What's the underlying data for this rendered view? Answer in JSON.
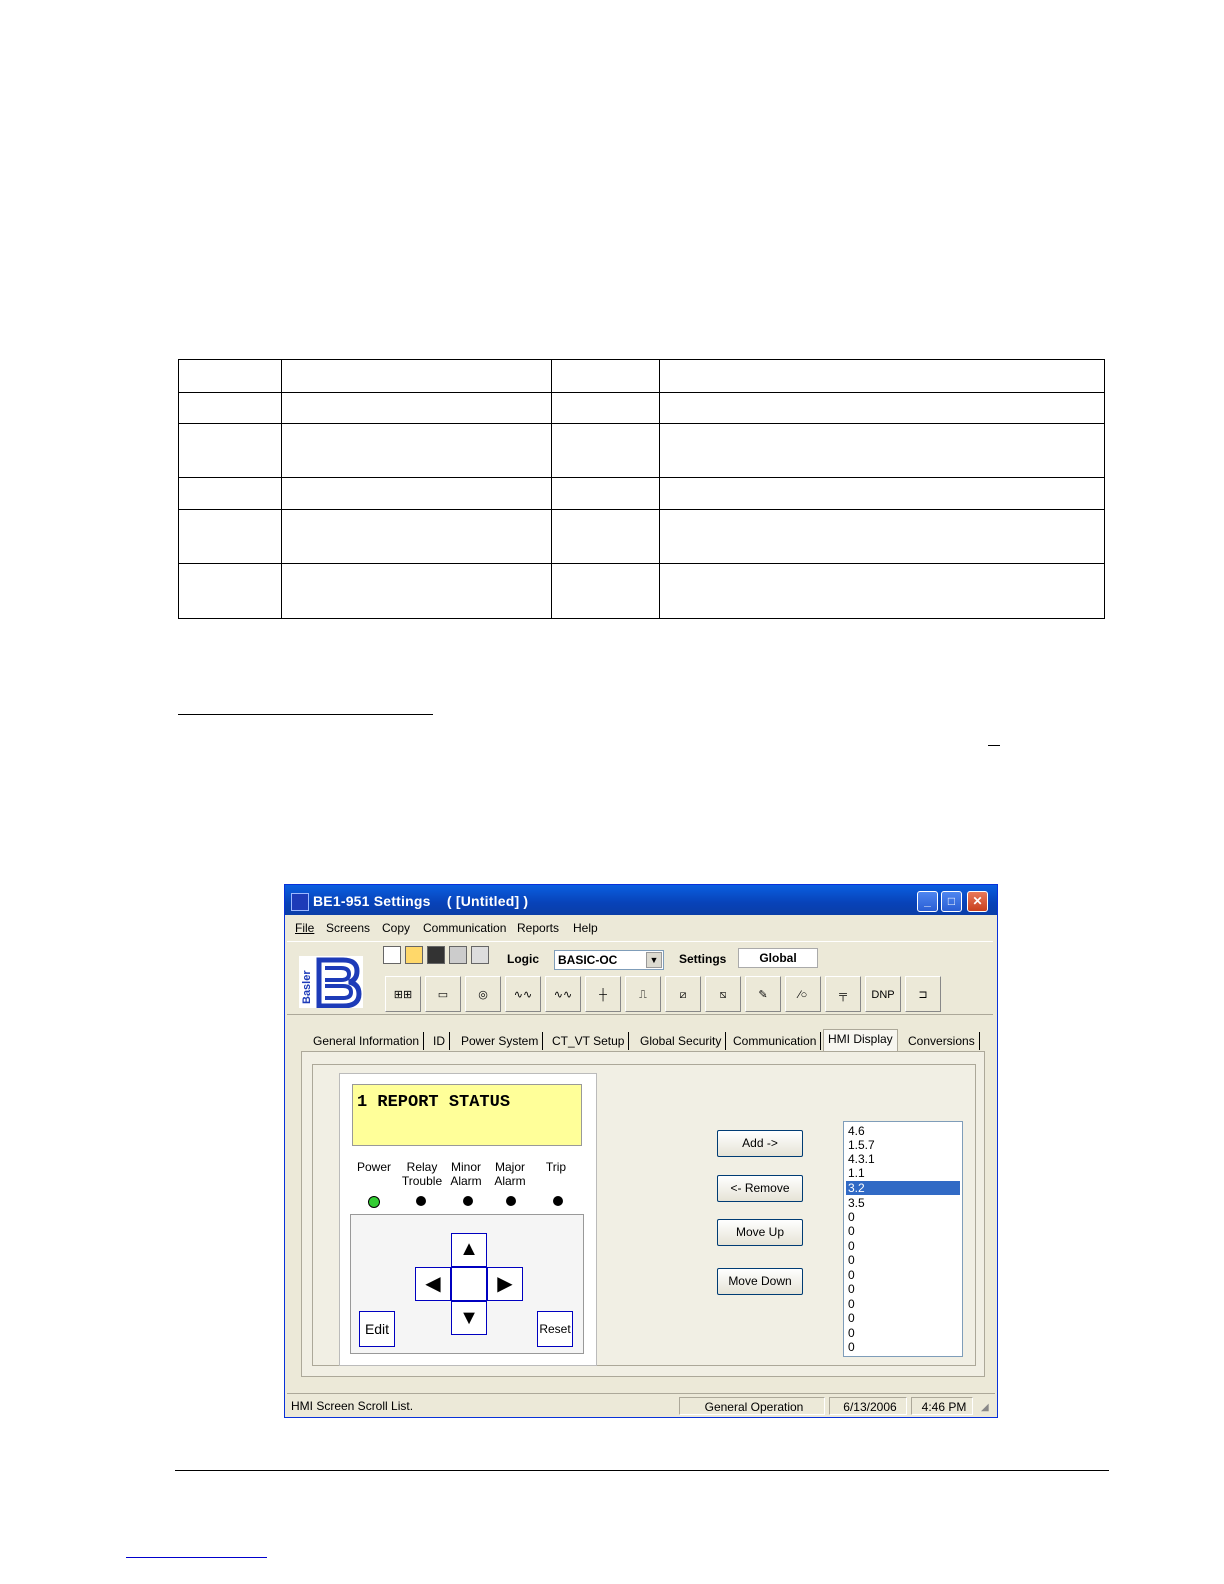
{
  "window": {
    "title": "BE1-951 Settings    ( [Untitled] )"
  },
  "menu": [
    "File",
    "Screens",
    "Copy",
    "Communication",
    "Reports",
    "Help"
  ],
  "toolbar": {
    "logic_label": "Logic",
    "logic_value": "BASIC-OC",
    "settings_label": "Settings",
    "settings_value": "Global",
    "dnp_label": "DNP",
    "brand_text": "Basler"
  },
  "tabs": [
    "General Information",
    "ID",
    "Power System",
    "CT_VT Setup",
    "Global Security",
    "Communication",
    "HMI Display",
    "Conversions"
  ],
  "hmi": {
    "lcd_text": "1 REPORT STATUS",
    "leds": [
      {
        "l1": "Power",
        "l2": ""
      },
      {
        "l1": "Relay",
        "l2": "Trouble"
      },
      {
        "l1": "Minor",
        "l2": "Alarm"
      },
      {
        "l1": "Major",
        "l2": "Alarm"
      },
      {
        "l1": "Trip",
        "l2": ""
      }
    ],
    "edit_label": "Edit",
    "reset_label": "Reset",
    "power_led_color": "#33cc33"
  },
  "buttons": {
    "add": "Add ->",
    "remove": "<- Remove",
    "move_up": "Move Up",
    "move_down": "Move Down"
  },
  "scroll_list": [
    "4.6",
    "1.5.7",
    "4.3.1",
    "1.1",
    "3.2",
    "3.5",
    "0",
    "0",
    "0",
    "0",
    "0",
    "0",
    "0",
    "0",
    "0",
    "0"
  ],
  "scroll_list_selected": "3.2",
  "status": {
    "message": "HMI Screen Scroll List.",
    "mode": "General Operation",
    "date": "6/13/2006",
    "time": "4:46 PM"
  }
}
